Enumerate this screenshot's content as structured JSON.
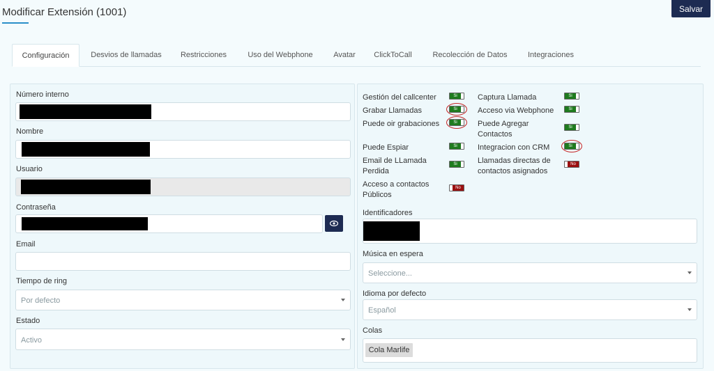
{
  "header": {
    "title": "Modificar Extensión (1001)",
    "save_label": "Salvar"
  },
  "tabs": [
    {
      "label": "Configuración",
      "active": true
    },
    {
      "label": "Desvios de llamadas"
    },
    {
      "label": "Restricciones"
    },
    {
      "label": "Uso del Webphone"
    },
    {
      "label": "Avatar"
    },
    {
      "label": "ClickToCall"
    },
    {
      "label": "Recolección de Datos"
    },
    {
      "label": "Integraciones"
    }
  ],
  "form_left": {
    "numero_interno": {
      "label": "Número interno",
      "value": ""
    },
    "nombre": {
      "label": "Nombre",
      "value": ""
    },
    "usuario": {
      "label": "Usuario",
      "value": ""
    },
    "contrasena": {
      "label": "Contraseña",
      "value": ""
    },
    "email": {
      "label": "Email",
      "value": ""
    },
    "tiempo_ring": {
      "label": "Tiempo de ring",
      "selected": "Por defecto"
    },
    "estado": {
      "label": "Estado",
      "selected": "Activo"
    }
  },
  "features": {
    "on_label": "Si",
    "off_label": "No",
    "items": [
      {
        "label": "Gestión del callcenter",
        "state": "on"
      },
      {
        "label": "Grabar Llamadas",
        "state": "on"
      },
      {
        "label": "Puede oir grabaciones",
        "state": "on"
      },
      {
        "label": "Puede Espiar",
        "state": "on"
      },
      {
        "label": "Email de LLamada Perdida",
        "state": "on"
      },
      {
        "label": "Acceso a contactos Públicos",
        "state": "off"
      },
      {
        "label": "Captura Llamada",
        "state": "on"
      },
      {
        "label": "Acceso via Webphone",
        "state": "on"
      },
      {
        "label": "Puede Agregar Contactos",
        "state": "on"
      },
      {
        "label": "Integracion con CRM",
        "state": "on"
      },
      {
        "label": "Llamadas directas de contactos asignados",
        "state": "off"
      }
    ]
  },
  "form_right": {
    "identificadores": {
      "label": "Identificadores",
      "value": ""
    },
    "musica": {
      "label": "Música en espera",
      "placeholder": "Seleccione..."
    },
    "idioma": {
      "label": "Idioma por defecto",
      "selected": "Español"
    },
    "colas": {
      "label": "Colas",
      "chip": "Cola Marlife"
    }
  },
  "colors": {
    "accent": "#2a8fc9",
    "button": "#1d2b52",
    "toggle_on": "#1e7b1e",
    "toggle_off": "#9b1010",
    "highlight": "#c62828"
  }
}
